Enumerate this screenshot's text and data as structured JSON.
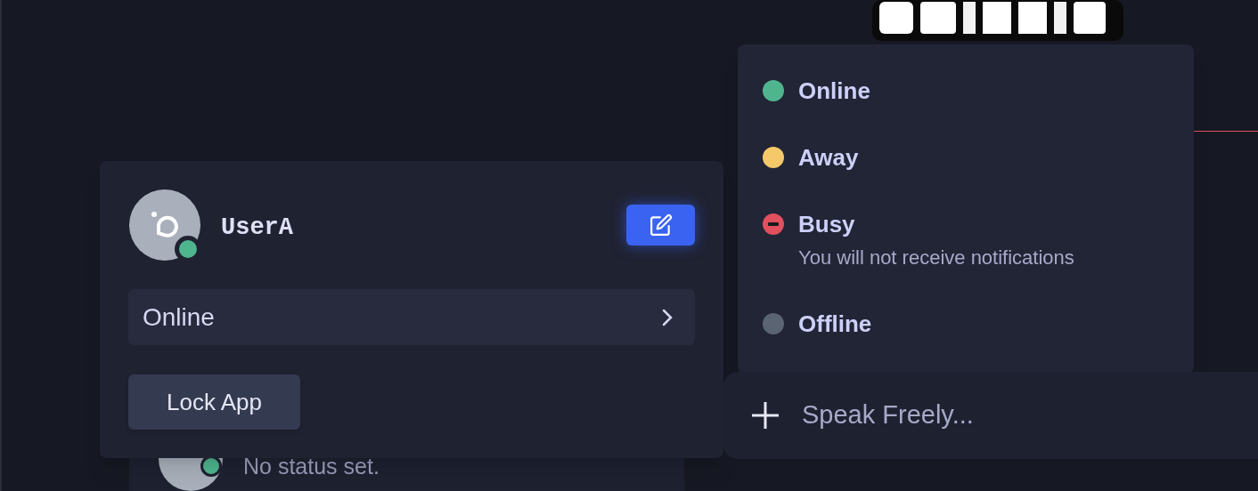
{
  "background_card": {
    "status_text": "No status set."
  },
  "profile_popover": {
    "username": "UserA",
    "status_select": {
      "value": "Online"
    },
    "lock_button": "Lock App"
  },
  "status_menu": [
    {
      "label": "Online",
      "kind": "dot",
      "color": "#4fb58e"
    },
    {
      "label": "Away",
      "kind": "dot",
      "color": "#f5c96a"
    },
    {
      "label": "Busy",
      "kind": "busy",
      "color": "#e0505e",
      "description": "You will not receive notifications"
    },
    {
      "label": "Offline",
      "kind": "dot",
      "color": "#5b6472"
    }
  ],
  "composer": {
    "placeholder": "Speak Freely..."
  }
}
